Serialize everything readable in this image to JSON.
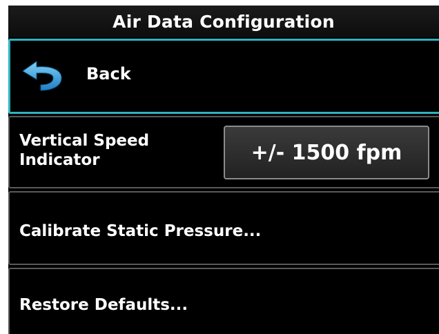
{
  "header": {
    "title": "Air Data Configuration"
  },
  "back": {
    "icon": "back-arrow-icon",
    "label": "Back",
    "icon_color": "#3aa8e0",
    "highlight_color": "#2fb3c0"
  },
  "settings": {
    "vertical_speed": {
      "label": "Vertical Speed Indicator",
      "value": "+/- 1500 fpm"
    },
    "calibrate": {
      "label": "Calibrate Static Pressure..."
    },
    "restore": {
      "label": "Restore Defaults..."
    }
  }
}
